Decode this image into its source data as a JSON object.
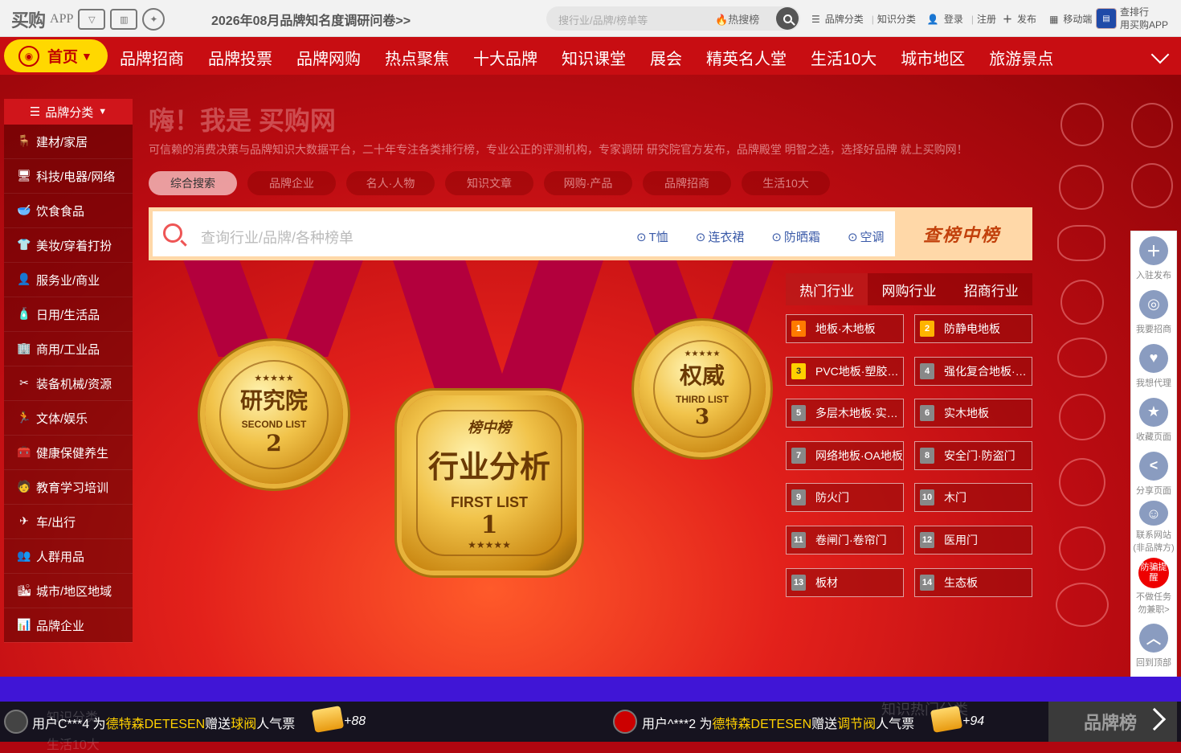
{
  "topbar": {
    "logo_text": "买购",
    "logo_app": "APP",
    "survey_link": "2026年08月品牌知名度调研问卷>>",
    "search_placeholder": "搜行业/品牌/榜单等",
    "hot_search": "热搜榜",
    "links": [
      "品牌分类",
      "知识分类",
      "登录",
      "注册",
      "发布",
      "移动端"
    ],
    "app_line1": "查排行",
    "app_line2": "用买购APP"
  },
  "nav": {
    "home": "首页",
    "items": [
      "品牌招商",
      "品牌投票",
      "品牌网购",
      "热点聚焦",
      "十大品牌",
      "知识课堂",
      "展会",
      "精英名人堂",
      "生活10大",
      "城市地区",
      "旅游景点"
    ]
  },
  "sidebar": {
    "title": "品牌分类",
    "items": [
      "建材/家居",
      "科技/电器/网络",
      "饮食食品",
      "美妆/穿着打扮",
      "服务业/商业",
      "日用/生活品",
      "商用/工业品",
      "装备机械/资源",
      "文体/娱乐",
      "健康保健养生",
      "教育学习培训",
      "车/出行",
      "人群用品",
      "城市/地区地域",
      "品牌企业"
    ]
  },
  "hero": {
    "greeting": "嗨！我是 买购网",
    "tagline": "可信赖的消费决策与品牌知识大数据平台，二十年专注各类排行榜，专业公正的评测机构，专家调研 研究院官方发布，品牌殿堂 明智之选，选择好品牌 就上买购网！",
    "search_tabs": [
      "综合搜索",
      "品牌企业",
      "名人·人物",
      "知识文章",
      "网购·产品",
      "品牌招商",
      "生活10大"
    ],
    "search_placeholder": "查询行业/品牌/各种榜单",
    "hints": [
      "T恤",
      "连衣裙",
      "防晒霜",
      "空调"
    ],
    "search_button": "查榜中榜",
    "medals": [
      {
        "title": "研究院",
        "sub": "SECOND LIST",
        "num": "2",
        "top": ""
      },
      {
        "title": "行业分析",
        "sub": "FIRST LIST",
        "num": "1",
        "top": "榜中榜"
      },
      {
        "title": "权威",
        "sub": "THIRD LIST",
        "num": "3",
        "top": ""
      }
    ]
  },
  "industry": {
    "tabs": [
      "热门行业",
      "网购行业",
      "招商行业"
    ],
    "items": [
      {
        "n": "1",
        "label": "地板·木地板"
      },
      {
        "n": "2",
        "label": "防静电地板"
      },
      {
        "n": "3",
        "label": "PVC地板·塑胶地板"
      },
      {
        "n": "4",
        "label": "强化复合地板·复合地板"
      },
      {
        "n": "5",
        "label": "多层木地板·实木复合地板"
      },
      {
        "n": "6",
        "label": "实木地板"
      },
      {
        "n": "7",
        "label": "网络地板·OA地板"
      },
      {
        "n": "8",
        "label": "安全门·防盗门"
      },
      {
        "n": "9",
        "label": "防火门"
      },
      {
        "n": "10",
        "label": "木门"
      },
      {
        "n": "11",
        "label": "卷闸门·卷帘门"
      },
      {
        "n": "12",
        "label": "医用门"
      },
      {
        "n": "13",
        "label": "板材"
      },
      {
        "n": "14",
        "label": "生态板"
      }
    ]
  },
  "rightpanel": {
    "items": [
      "入驻发布",
      "我要招商",
      "我想代理",
      "收藏页面",
      "分享页面",
      "联系网站(非品牌方)"
    ],
    "warn_badge": "防骗提醒",
    "warn_text": "不做任务勿兼职>",
    "top": "回到顶部"
  },
  "ticker": {
    "t1_user": "用户C***4 为",
    "t1_brand": "德特森DETESEN",
    "t1_mid": "赠送",
    "t1_item": "球阀",
    "t1_end": "人气票",
    "t1_plus": "+88",
    "t2_user": "用户^***2 为",
    "t2_brand": "德特森DETESEN",
    "t2_mid": "赠送",
    "t2_item": "调节阀",
    "t2_end": "人气票",
    "t2_plus": "+94",
    "ghost_left": "知识分类",
    "ghost_left2": "生活10大",
    "ghost_right": "知识热门分类",
    "brand_rank": "品牌榜"
  }
}
